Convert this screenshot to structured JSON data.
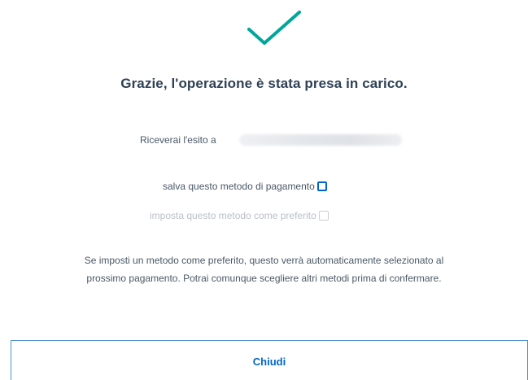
{
  "icons": {
    "success": "check-icon"
  },
  "colors": {
    "accent": "#0066cc",
    "success": "#00a69a"
  },
  "confirmation": {
    "title": "Grazie, l'operazione è stata presa in carico.",
    "outcome_label": "Riceverai l'esito a"
  },
  "options": {
    "save_method": {
      "label": "salva questo metodo di pagamento",
      "checked": false,
      "enabled": true
    },
    "set_preferred": {
      "label": "imposta questo metodo come preferito",
      "checked": false,
      "enabled": false
    }
  },
  "info": {
    "line1": "Se imposti un metodo come preferito, questo verrà automaticamente selezionato al",
    "line2": "prossimo pagamento. Potrai comunque scegliere altri metodi prima di confermare."
  },
  "actions": {
    "close_label": "Chiudi"
  }
}
